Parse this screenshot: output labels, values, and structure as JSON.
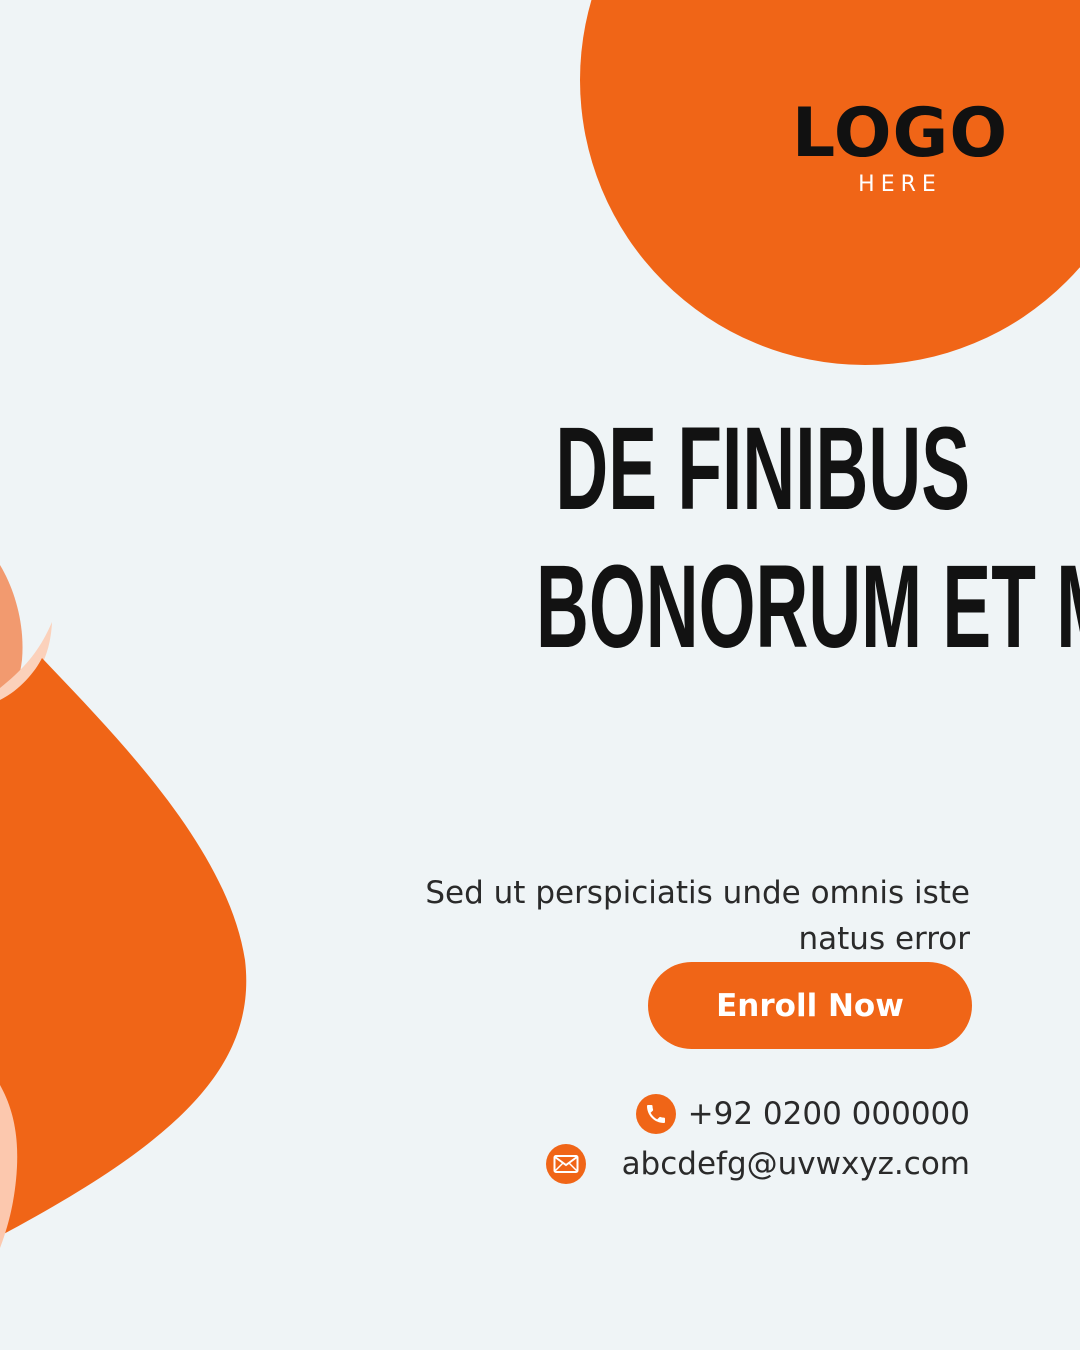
{
  "logo": {
    "main": "LOGO",
    "sub": "HERE"
  },
  "headline": {
    "line1": "DE FINIBUS",
    "line2": "BONORUM ET M"
  },
  "body_text": "Sed ut perspiciatis unde omnis iste natus error",
  "cta_label": "Enroll Now",
  "contact": {
    "phone": "+92 0200 000000",
    "email": "abcdefg@uvwxyz.com",
    "phone_icon": "phone-icon",
    "email_icon": "envelope-icon"
  },
  "colors": {
    "background": "#eff4f6",
    "accent": "#f06517",
    "accent_light": "#f5a27a",
    "accent_pale": "#fbd1bb",
    "text_dark": "#121212",
    "text_body": "#2a2a2a"
  }
}
